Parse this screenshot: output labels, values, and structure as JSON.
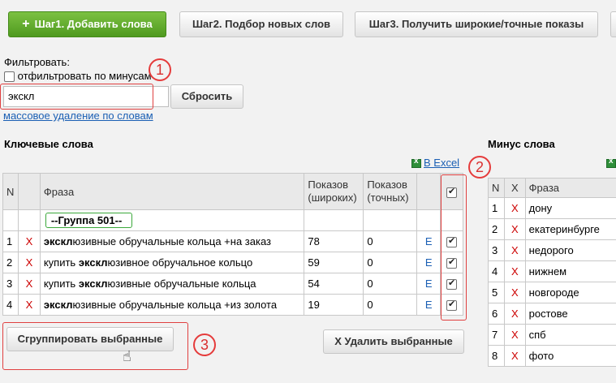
{
  "steps": {
    "step1": "Шаг1. Добавить слова",
    "step2": "Шаг2. Подбор новых слов",
    "step3": "Шаг3. Получить широкие/точные показы"
  },
  "filter": {
    "label": "Фильтровать:",
    "minus_filter_label": "отфильтровать по минусам",
    "minus_filter_checked": false,
    "search_value": "экскл",
    "reset_button": "Сбросить",
    "mass_delete_link": "массовое удаление по словам"
  },
  "keywords": {
    "title": "Ключевые слова",
    "excel_link": "В Excel",
    "columns": {
      "n": "N",
      "phrase": "Фраза",
      "broad": "Показов\n(широких)",
      "exact": "Показов\n(точных)"
    },
    "group_label": "--Группа 501--",
    "rows": [
      {
        "n": "1",
        "x": "X",
        "bold": "экскл",
        "rest": "юзивные обручальные кольца +на заказ",
        "broad": "78",
        "exact": "0",
        "edit": "E",
        "checked": true
      },
      {
        "n": "2",
        "x": "X",
        "pre": "купить ",
        "bold": "экскл",
        "rest": "юзивное обручальное кольцо",
        "broad": "59",
        "exact": "0",
        "edit": "E",
        "checked": true
      },
      {
        "n": "3",
        "x": "X",
        "pre": "купить ",
        "bold": "экскл",
        "rest": "юзивные обручальные кольца",
        "broad": "54",
        "exact": "0",
        "edit": "E",
        "checked": true
      },
      {
        "n": "4",
        "x": "X",
        "bold": "экскл",
        "rest": "юзивные обручальные кольца +из золота",
        "broad": "19",
        "exact": "0",
        "edit": "E",
        "checked": true
      }
    ],
    "group_button": "Сгруппировать выбранные",
    "delete_button": "X Удалить выбранные"
  },
  "minus": {
    "title": "Минус слова",
    "columns": {
      "n": "N",
      "x": "X",
      "phrase": "Фраза"
    },
    "rows": [
      {
        "n": "1",
        "x": "X",
        "phrase": "дону"
      },
      {
        "n": "2",
        "x": "X",
        "phrase": "екатеринбурге"
      },
      {
        "n": "3",
        "x": "X",
        "phrase": "недорого"
      },
      {
        "n": "4",
        "x": "X",
        "phrase": "нижнем"
      },
      {
        "n": "5",
        "x": "X",
        "phrase": "новгороде"
      },
      {
        "n": "6",
        "x": "X",
        "phrase": "ростове"
      },
      {
        "n": "7",
        "x": "X",
        "phrase": "спб"
      },
      {
        "n": "8",
        "x": "X",
        "phrase": "фото"
      }
    ]
  },
  "callouts": [
    "1",
    "2",
    "3"
  ],
  "colors": {
    "accent_green": "#5aa628",
    "callout_red": "#e53b3b",
    "link_blue": "#1a5fb4"
  }
}
